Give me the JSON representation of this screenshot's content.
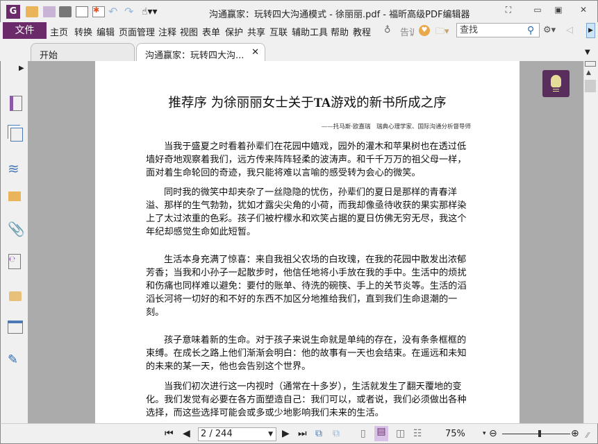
{
  "window": {
    "title": "沟通赢家：玩转四大沟通模式 - 徐丽丽.pdf - 福昕高级PDF编辑器"
  },
  "menu": {
    "file": "文件",
    "items": [
      "主页",
      "转换",
      "编辑",
      "页面管理",
      "注释",
      "视图",
      "表单",
      "保护",
      "共享",
      "互联",
      "辅助工具",
      "帮助",
      "教程"
    ],
    "tell_me": "告诉",
    "search_placeholder": "查找"
  },
  "tabs": [
    {
      "label": "开始"
    },
    {
      "label": "沟通赢家：玩转四大沟..."
    }
  ],
  "document": {
    "title_pre": "推荐序 为徐丽丽女士关于",
    "title_bold": "TA",
    "title_post": "游戏的新书所成之序",
    "byline": "——托马斯·欧嘉瑞　瑞典心理学家、国际沟通分析督导师",
    "paragraphs": [
      [
        "当我于盛夏之时看着孙辈们在花园中嬉戏，园外的灌木和苹果树也在透过低",
        "墙好奇地观察着我们，远方传来阵阵轻柔的波涛声。和千千万万的祖父母一样，",
        "面对着生命轮回的奇迹，我只能将难以言喻的感受转为会心的微笑。"
      ],
      [
        "同时我的微笑中却夹杂了一丝隐隐的忧伤，孙辈们的夏日是那样的青春洋",
        "溢、那样的生气勃勃，犹如才露尖尖角的小荷，而我却像亟待收获的果实那样染",
        "上了太过浓重的色彩。孩子们被柠檬水和欢笑占据的夏日仿佛无穷无尽，我这个",
        "年纪却感觉生命如此短暂。"
      ],
      [
        "生活本身充满了惊喜：来自我祖父农场的白玫瑰，在我的花园中散发出浓郁",
        "芳香；当我和小孙子一起散步时，他信任地将小手放在我的手中。生活中的烦扰",
        "和伤痛也同样难以避免：要付的账单、待洗的碗筷、手上的关节炎等。生活的滔",
        "滔长河将一切好的和不好的东西不加区分地推给我们，直到我们生命退潮的一",
        "刻。"
      ],
      [
        "孩子意味着新的生命。对于孩子来说生命就是单纯的存在，没有条条框框的",
        "束缚。在成长之路上他们渐渐会明白：他的故事有一天也会结束。在遥远和未知",
        "的未来的某一天，他也会告别这个世界。"
      ],
      [
        "当我们初次进行这一内视时（通常在十多岁），生活就发生了翻天覆地的变",
        "化。我们发觉有必要在各方面塑造自己：我们可以，或者说，我们必须做出各种",
        "选择，而这些选择可能会或多或少地影响我们未来的生活。"
      ]
    ]
  },
  "status": {
    "page": "2 / 244",
    "zoom": "75%",
    "zoom_fraction": 0.55
  },
  "colors": {
    "brand": "#6b2b6b",
    "accent": "#4a7ab5"
  }
}
